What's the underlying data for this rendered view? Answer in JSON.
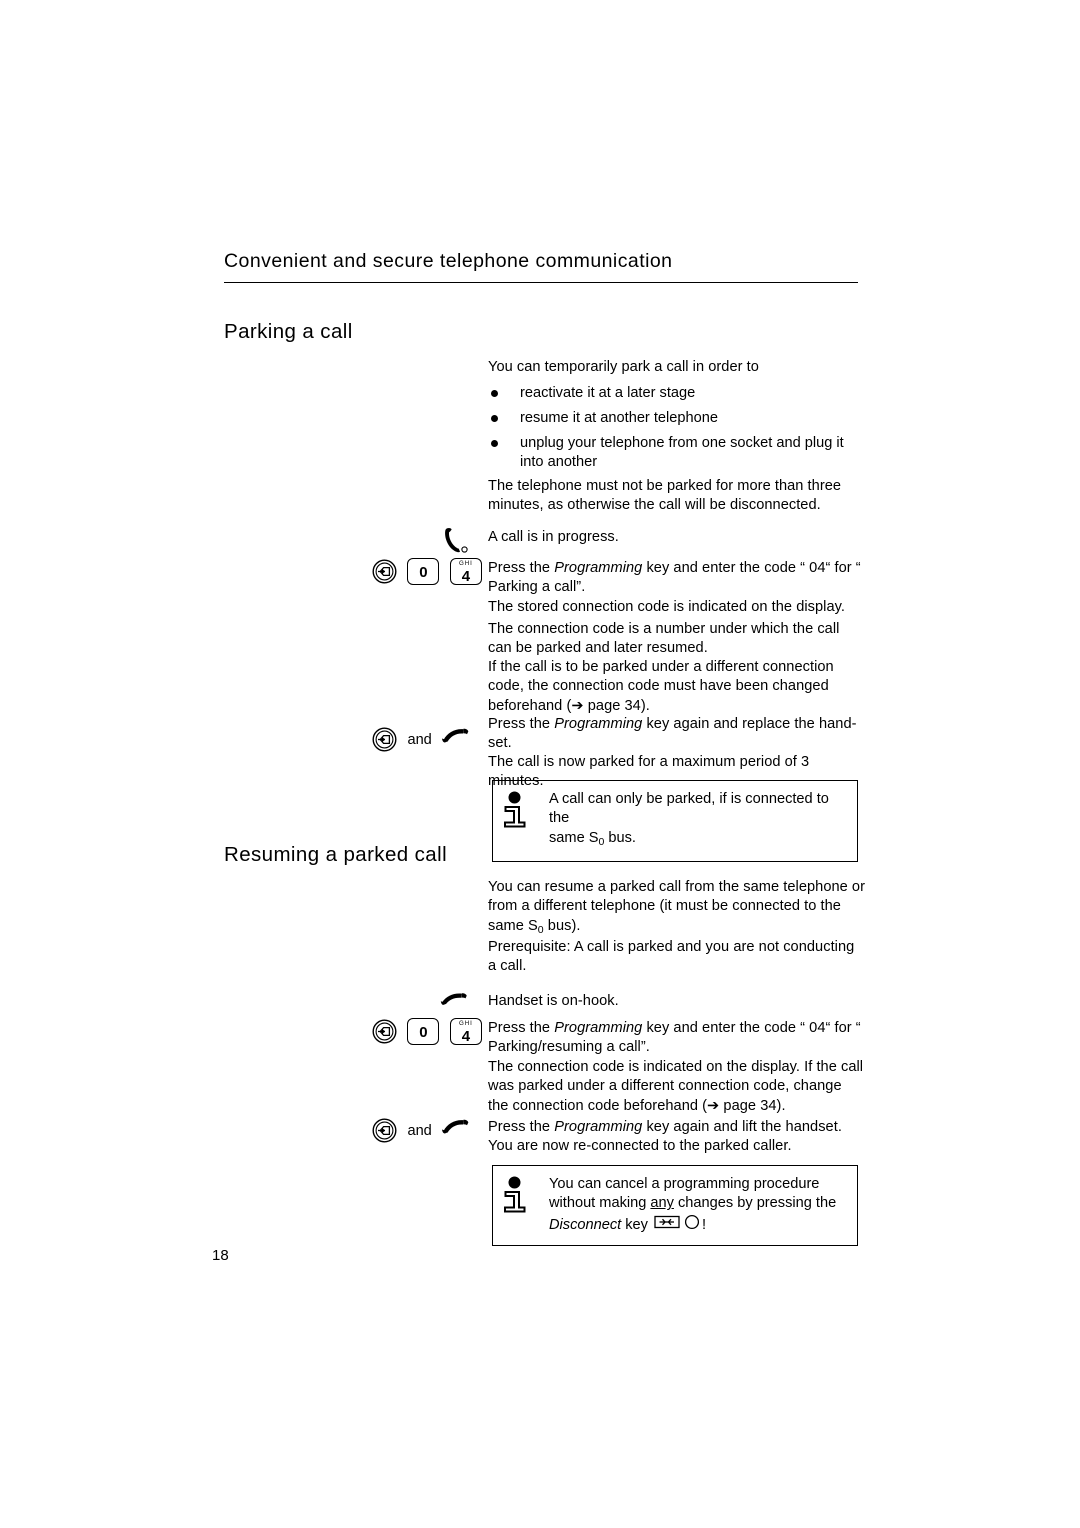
{
  "page": {
    "folio": "18",
    "running_header": "Convenient and secure telephone communication"
  },
  "sections": [
    {
      "heading": "Parking a call",
      "intro": "You can temporarily park a call in order to",
      "bullets": [
        "reactivate it at a later stage",
        "resume it at another telephone",
        "unplug your telephone from one socket and plug it into another"
      ],
      "after_bullets": "The telephone must not be parked for more than three minutes, as otherwise the call will be disconnected.",
      "steps": [
        {
          "icons": [
            "handset-offhook-icon"
          ],
          "text": "A call is in progress."
        },
        {
          "icons": [
            "programming-key-icon",
            "key-0-icon",
            "key-4-ghi-icon"
          ],
          "text_parts": [
            {
              "t": "Press the ",
              "style": "normal"
            },
            {
              "t": "Programming",
              "style": "italic"
            },
            {
              "t": " key and enter the code “ 04“  for “ Parking a call”.",
              "style": "normal"
            }
          ]
        }
      ],
      "paragraphs": [
        "The stored connection code is indicated on the display.",
        "The connection code is a number under which the call can be parked and later resumed.",
        "If the call is to be parked under a different connection code, the connection code must have been changed beforehand (➔ page 34)."
      ],
      "final_step": {
        "icons": [
          "programming-key-icon",
          "and-label",
          "handset-onhook-replace-icon"
        ],
        "and_label": "and",
        "text_parts": [
          {
            "t": "Press the ",
            "style": "normal"
          },
          {
            "t": "Programming",
            "style": "italic"
          },
          {
            "t": " key again and replace the hand-set.",
            "style": "normal"
          }
        ],
        "follow_up": "The call is now parked for a maximum period of 3 minutes."
      },
      "note": {
        "icon": "info-icon",
        "line1": "A call can only be parked, if is connected to the",
        "line2_pre": "same S",
        "line2_sub": "0",
        "line2_post": " bus."
      }
    },
    {
      "heading": "Resuming a parked call",
      "intro_parts": [
        {
          "t": "You can resume a parked call from the same telephone or from a different telephone (it must be connected to the same S",
          "style": "normal"
        },
        {
          "t": "0",
          "style": "sub"
        },
        {
          "t": " bus).",
          "style": "normal"
        }
      ],
      "prerequisite": "Prerequisite: A call is parked and you are not conducting a call.",
      "steps": [
        {
          "icons": [
            "handset-onhook-icon"
          ],
          "text": "Handset is on-hook."
        },
        {
          "icons": [
            "programming-key-icon",
            "key-0-icon",
            "key-4-ghi-icon"
          ],
          "text_parts": [
            {
              "t": "Press the ",
              "style": "normal"
            },
            {
              "t": "Programming",
              "style": "italic"
            },
            {
              "t": " key and enter the code “ 04“  for “ Parking/resuming a call”.",
              "style": "normal"
            }
          ]
        }
      ],
      "paragraphs": [
        "The connection code is indicated on the display. If the call was parked under a different connection code, change the connection code beforehand (➔ page 34)."
      ],
      "final_step": {
        "icons": [
          "programming-key-icon",
          "and-label",
          "handset-onhook-replace-icon"
        ],
        "and_label": "and",
        "text_parts": [
          {
            "t": "Press the ",
            "style": "normal"
          },
          {
            "t": "Programming",
            "style": "italic"
          },
          {
            "t": " key again and lift the handset.",
            "style": "normal"
          }
        ],
        "follow_up": "You are now re-connected to the parked caller."
      },
      "note": {
        "icon": "info-icon",
        "line1": "You can cancel a programming procedure",
        "line2_pre": "without making ",
        "line2_underlined": "any",
        "line2_post": " changes by pressing the",
        "line3_italic": "Disconnect",
        "line3_post": " key",
        "line3_icons": [
          "disconnect-key-icon",
          "circle-icon"
        ],
        "line3_end": "!"
      }
    }
  ],
  "keys": {
    "key_0_digit": "0",
    "key_4_digit": "4",
    "key_4_letters": "GHI"
  }
}
